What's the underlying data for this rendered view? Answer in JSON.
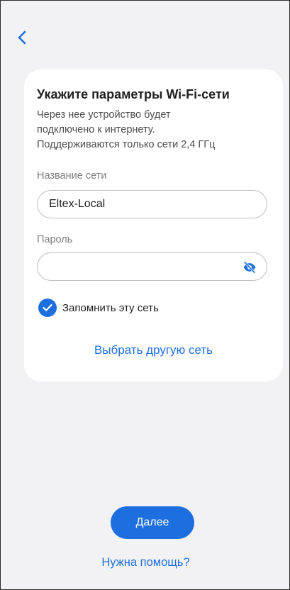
{
  "colors": {
    "accent": "#1d6fe0",
    "background": "#f2f2f4",
    "card": "#ffffff"
  },
  "header": {
    "back_icon": "chevron-left-icon"
  },
  "form": {
    "title": "Укажите параметры Wi-Fi-сети",
    "description_lines": [
      "Через нее устройство будет",
      "подключено к интернету.",
      "Поддерживаются только сети 2,4 ГГц"
    ],
    "network_name": {
      "label": "Название сети",
      "value": "Eltex-Local"
    },
    "password": {
      "label": "Пароль",
      "value": "",
      "toggle_icon": "eye-off-icon"
    },
    "remember": {
      "label": "Запомнить эту сеть",
      "checked": true
    },
    "choose_other_label": "Выбрать другую сеть"
  },
  "footer": {
    "next_label": "Далее",
    "help_label": "Нужна помощь?"
  }
}
